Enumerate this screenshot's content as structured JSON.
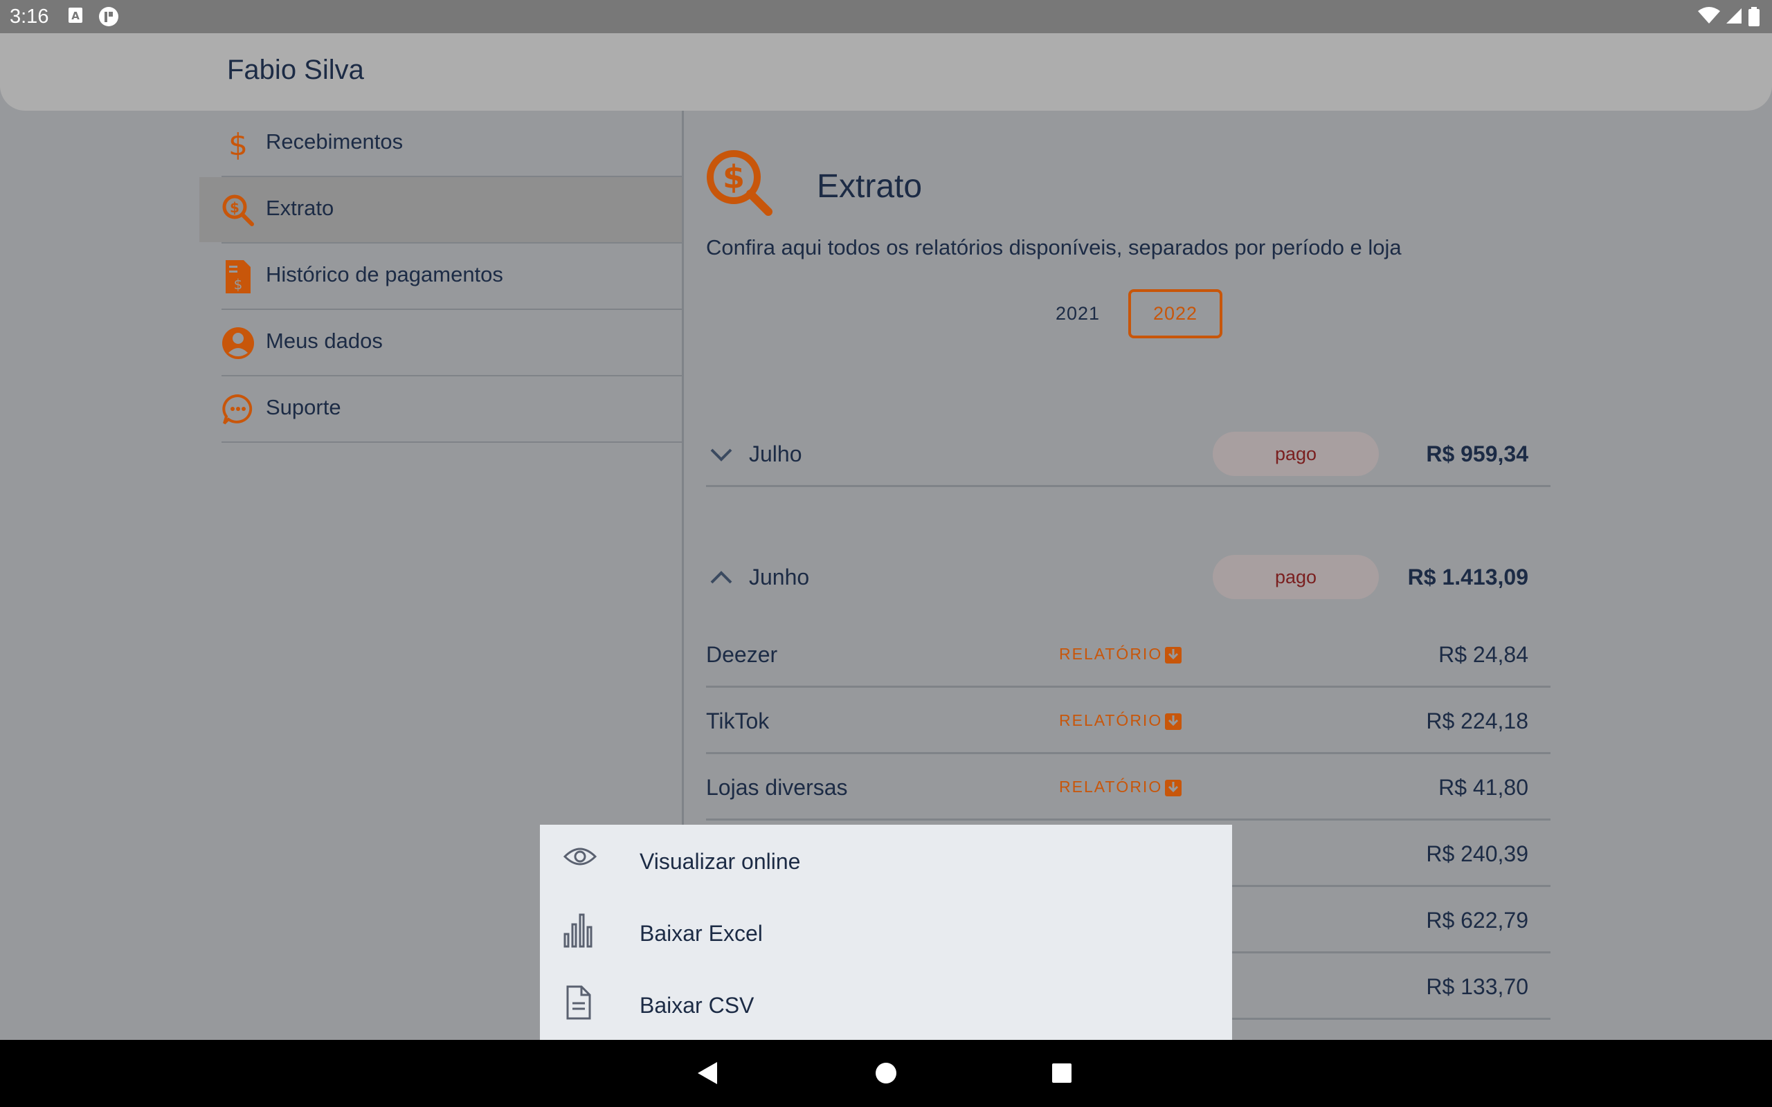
{
  "status_bar": {
    "time": "3:16",
    "icons": [
      "a-notification-icon",
      "app-notification-icon",
      "wifi-icon",
      "signal-icon",
      "battery-icon"
    ]
  },
  "header": {
    "title": "Fabio Silva"
  },
  "sidebar": {
    "items": [
      {
        "label": "Recebimentos",
        "icon": "dollar-icon",
        "selected": false
      },
      {
        "label": "Extrato",
        "icon": "search-dollar-icon",
        "selected": true
      },
      {
        "label": "Histórico de pagamentos",
        "icon": "invoice-icon",
        "selected": false
      },
      {
        "label": "Meus dados",
        "icon": "user-icon",
        "selected": false
      },
      {
        "label": "Suporte",
        "icon": "chat-icon",
        "selected": false
      }
    ]
  },
  "main": {
    "title": "Extrato",
    "subtitle": "Confira aqui todos os relatórios disponíveis, separados por período e loja",
    "years": [
      "2021",
      "2022"
    ],
    "selected_year": "2022",
    "months": [
      {
        "label": "Julho",
        "status": "pago",
        "amount": "R$ 959,34",
        "expanded": false
      },
      {
        "label": "Junho",
        "status": "pago",
        "amount": "R$ 1.413,09",
        "expanded": true
      }
    ],
    "report_label": "RELATÓRIO",
    "items": [
      {
        "name": "Deezer",
        "amount": "R$ 24,84"
      },
      {
        "name": "TikTok",
        "amount": "R$ 224,18"
      },
      {
        "name": "Lojas diversas",
        "amount": "R$ 41,80"
      },
      {
        "name": "",
        "amount": "R$ 240,39"
      },
      {
        "name": "",
        "amount": "R$ 622,79"
      },
      {
        "name": "",
        "amount": "R$ 133,70"
      }
    ]
  },
  "sheet": {
    "options": [
      {
        "label": "Visualizar online",
        "icon": "eye-icon"
      },
      {
        "label": "Baixar Excel",
        "icon": "bar-chart-icon"
      },
      {
        "label": "Baixar CSV",
        "icon": "file-icon"
      }
    ]
  },
  "colors": {
    "accent": "#c8560a",
    "text": "#1c2b45",
    "status_pago": "#7a1f1f"
  }
}
